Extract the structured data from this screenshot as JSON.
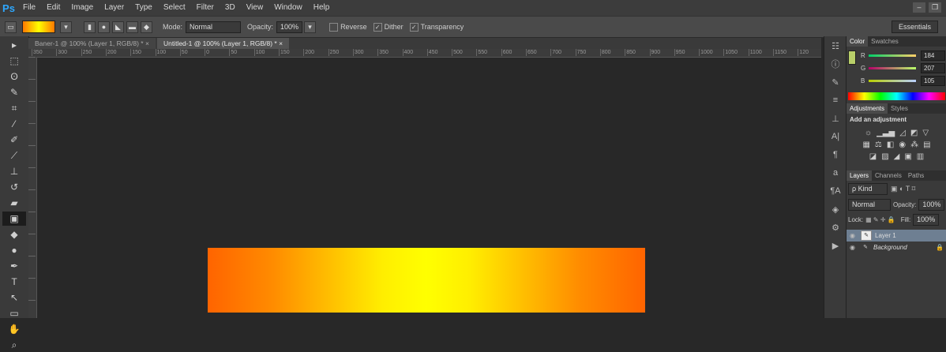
{
  "app": {
    "logo": "Ps"
  },
  "menu": [
    "File",
    "Edit",
    "Image",
    "Layer",
    "Type",
    "Select",
    "Filter",
    "3D",
    "View",
    "Window",
    "Help"
  ],
  "window_controls": {
    "minimize": "–",
    "restore": "❐"
  },
  "options_bar": {
    "mode_label": "Mode:",
    "mode_value": "Normal",
    "opacity_label": "Opacity:",
    "opacity_value": "100%",
    "reverse_label": "Reverse",
    "dither_label": "Dither",
    "transparency_label": "Transparency",
    "dither_checked": true,
    "transparency_checked": true,
    "reverse_checked": false,
    "workspace": "Essentials"
  },
  "tabs": [
    {
      "label": "Baner-1 @ 100% (Layer 1, RGB/8) *",
      "active": false
    },
    {
      "label": "Untitled-1 @ 100% (Layer 1, RGB/8) *",
      "active": true
    }
  ],
  "ruler_ticks": [
    "350",
    "300",
    "250",
    "200",
    "150",
    "100",
    "50",
    "0",
    "50",
    "100",
    "150",
    "200",
    "250",
    "300",
    "350",
    "400",
    "450",
    "500",
    "550",
    "600",
    "650",
    "700",
    "750",
    "800",
    "850",
    "900",
    "950",
    "1000",
    "1050",
    "1100",
    "1150",
    "120"
  ],
  "canvas": {
    "gradient_colors": [
      "#ff6400",
      "#ffff00",
      "#ff6400"
    ]
  },
  "color_panel": {
    "tabs": [
      "Color",
      "Swatches"
    ],
    "channels": [
      {
        "label": "R",
        "value": "184"
      },
      {
        "label": "G",
        "value": "207"
      },
      {
        "label": "B",
        "value": "105"
      }
    ],
    "foreground_color": "#b8cf69"
  },
  "adjustments_panel": {
    "tabs": [
      "Adjustments",
      "Styles"
    ],
    "heading": "Add an adjustment"
  },
  "layers_panel": {
    "tabs": [
      "Layers",
      "Channels",
      "Paths"
    ],
    "kind_label": "ρ Kind",
    "blend_mode": "Normal",
    "opacity_label": "Opacity:",
    "opacity_value": "100%",
    "lock_label": "Lock:",
    "fill_label": "Fill:",
    "fill_value": "100%",
    "layers": [
      {
        "name": "Layer 1",
        "selected": true
      },
      {
        "name": "Background",
        "selected": false
      }
    ]
  }
}
